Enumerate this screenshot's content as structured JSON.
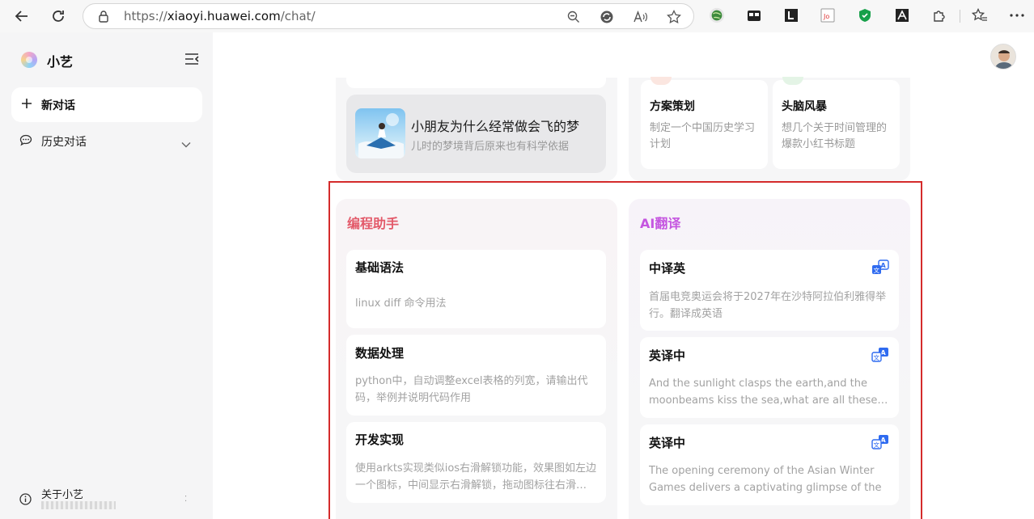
{
  "browser": {
    "url_scheme": "https://",
    "url_host": "xiaoyi.huawei.com",
    "url_path": "/chat/"
  },
  "sidebar": {
    "brand": "小艺",
    "new_chat": "新对话",
    "history": "历史对话",
    "about": "关于小艺"
  },
  "top": {
    "story_title": "小朋友为什么经常做会飞的梦",
    "story_desc": "儿时的梦境背后原来也有科学依据",
    "cards": [
      {
        "title": "方案策划",
        "desc": "制定一个中国历史学习计划"
      },
      {
        "title": "头脑风暴",
        "desc": "想几个关于时间管理的爆款小红书标题"
      }
    ]
  },
  "coding": {
    "title": "编程助手",
    "cards": [
      {
        "title": "基础语法",
        "desc": "linux diff 命令用法"
      },
      {
        "title": "数据处理",
        "desc": "python中，自动调整excel表格的列宽，请输出代码，举例并说明代码作用"
      },
      {
        "title": "开发实现",
        "desc": "使用arkts实现类似ios右滑解锁功能，效果图如左边一个图标，中间显示右滑解锁，拖动图标往右滑…"
      }
    ]
  },
  "translate": {
    "title": "AI翻译",
    "cards": [
      {
        "title": "中译英",
        "desc": "首届电竞奥运会将于2027年在沙特阿拉伯利雅得举行。翻译成英语"
      },
      {
        "title": "英译中",
        "desc": "And the sunlight clasps the earth,and the moonbeams kiss the sea,what are all these…"
      },
      {
        "title": "英译中",
        "desc": "The opening ceremony of the Asian Winter Games delivers a captivating glimpse of the host city's…"
      }
    ]
  },
  "colors": {
    "coding_accent": "#e35a6a",
    "translate_accent": "#c556e0",
    "highlight_border": "#d42b2b",
    "translate_icon": "#2f6bf0"
  }
}
